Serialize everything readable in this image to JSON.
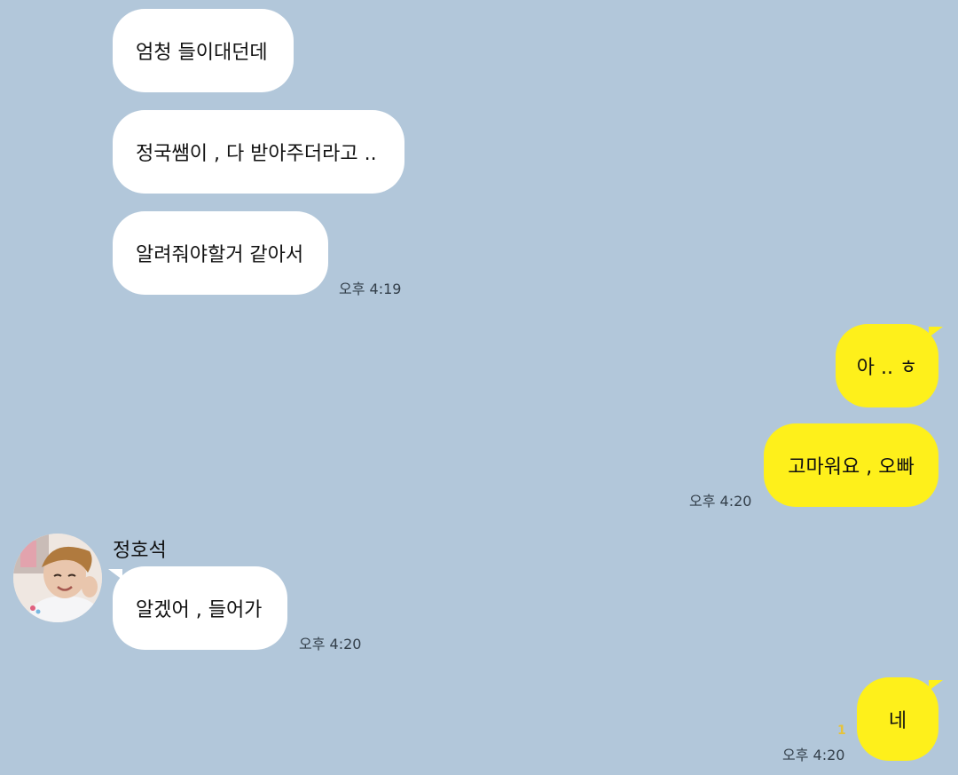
{
  "messages": {
    "m1": "엄청 들이대던데",
    "m2": "정국쌤이 , 다 받아주더라고 ..",
    "m3": "알려줘야할거 같아서",
    "m4": "아 .. ㅎ",
    "m5": "고마워요 , 오빠",
    "m6": "알겠어 , 들어가",
    "m7": "네"
  },
  "timestamps": {
    "t1": "오후 4:19",
    "t2": "오후 4:20",
    "t3": "오후 4:20",
    "t4": "오후 4:20"
  },
  "sender": {
    "name": "정호석"
  },
  "read_receipt": "1",
  "colors": {
    "background": "#b2c7da",
    "incoming_bubble": "#ffffff",
    "outgoing_bubble": "#fef01b",
    "unread_count": "#e6c33a"
  }
}
